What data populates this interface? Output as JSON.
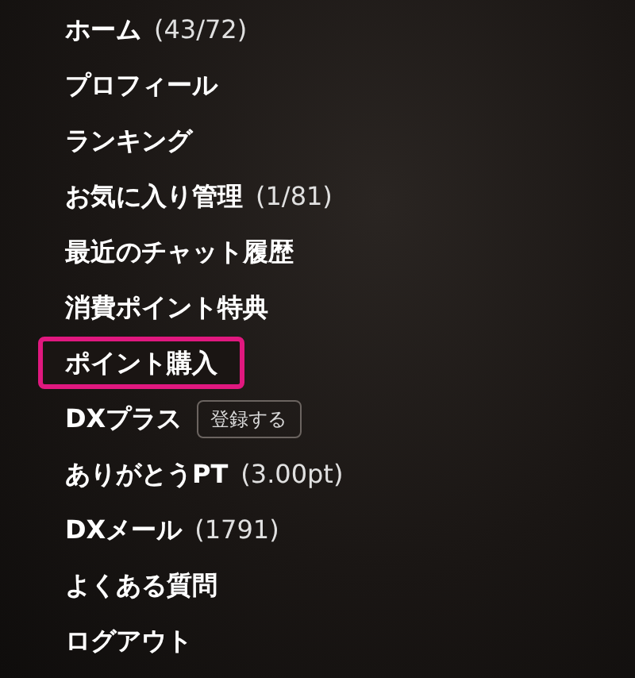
{
  "menu": {
    "items": [
      {
        "label": "ホーム",
        "count": "(43/72)",
        "selected": false
      },
      {
        "label": "プロフィール",
        "selected": false
      },
      {
        "label": "ランキング",
        "selected": false
      },
      {
        "label": "お気に入り管理",
        "count": "(1/81)",
        "selected": false
      },
      {
        "label": "最近のチャット履歴",
        "selected": false
      },
      {
        "label": "消費ポイント特典",
        "selected": false
      },
      {
        "label": "ポイント購入",
        "selected": true
      },
      {
        "label": "DXプラス",
        "button": "登録する",
        "selected": false
      },
      {
        "label": "ありがとうPT",
        "count": "(3.00pt)",
        "selected": false
      },
      {
        "label": "DXメール",
        "count": "(1791)",
        "selected": false
      },
      {
        "label": "よくある質問",
        "selected": false
      },
      {
        "label": "ログアウト",
        "selected": false
      }
    ]
  }
}
